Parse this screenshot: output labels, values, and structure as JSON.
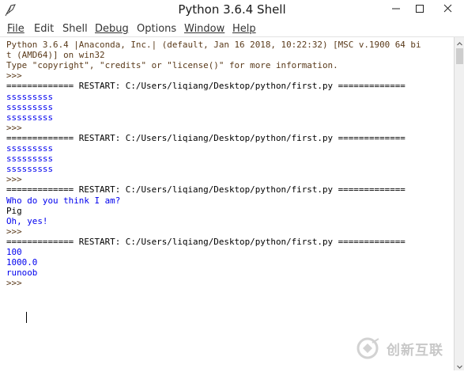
{
  "window": {
    "title": "Python 3.6.4 Shell",
    "icon": "python-feather-icon",
    "controls": [
      "minimize-icon",
      "maximize-icon",
      "close-icon"
    ]
  },
  "menu": [
    {
      "label": "File"
    },
    {
      "label": "Edit"
    },
    {
      "label": "Shell"
    },
    {
      "label": "Debug"
    },
    {
      "label": "Options"
    },
    {
      "label": "Window"
    },
    {
      "label": "Help"
    }
  ],
  "shell": {
    "lines": [
      {
        "text": "Python 3.6.4 |Anaconda, Inc.| (default, Jan 16 2018, 10:22:32) [MSC v.1900 64 bi",
        "style": "dark"
      },
      {
        "text": "t (AMD64)] on win32",
        "style": "dark"
      },
      {
        "text": "Type \"copyright\", \"credits\" or \"license()\" for more information.",
        "style": "dark"
      },
      {
        "text": ">>> ",
        "style": "dark"
      },
      {
        "text": "============= RESTART: C:/Users/liqiang/Desktop/python/first.py =============",
        "style": "black"
      },
      {
        "text": "sssssssss",
        "style": "blue"
      },
      {
        "text": "sssssssss",
        "style": "blue"
      },
      {
        "text": "sssssssss",
        "style": "blue"
      },
      {
        "text": ">>> ",
        "style": "dark"
      },
      {
        "text": "============= RESTART: C:/Users/liqiang/Desktop/python/first.py =============",
        "style": "black"
      },
      {
        "text": "sssssssss",
        "style": "blue"
      },
      {
        "text": "sssssssss",
        "style": "blue"
      },
      {
        "text": "sssssssss",
        "style": "blue"
      },
      {
        "text": ">>> ",
        "style": "dark"
      },
      {
        "text": "============= RESTART: C:/Users/liqiang/Desktop/python/first.py =============",
        "style": "black"
      },
      {
        "text": "Who do you think I am?",
        "style": "blue"
      },
      {
        "text": "Pig",
        "style": "black"
      },
      {
        "text": "Oh, yes!",
        "style": "blue"
      },
      {
        "text": ">>> ",
        "style": "dark"
      },
      {
        "text": "============= RESTART: C:/Users/liqiang/Desktop/python/first.py =============",
        "style": "black"
      },
      {
        "text": "100",
        "style": "blue"
      },
      {
        "text": "1000.0",
        "style": "blue"
      },
      {
        "text": "runoob",
        "style": "blue"
      },
      {
        "text": ">>> ",
        "style": "dark"
      }
    ]
  },
  "watermark": {
    "text": "创新互联",
    "color": "#c8c8c8"
  }
}
